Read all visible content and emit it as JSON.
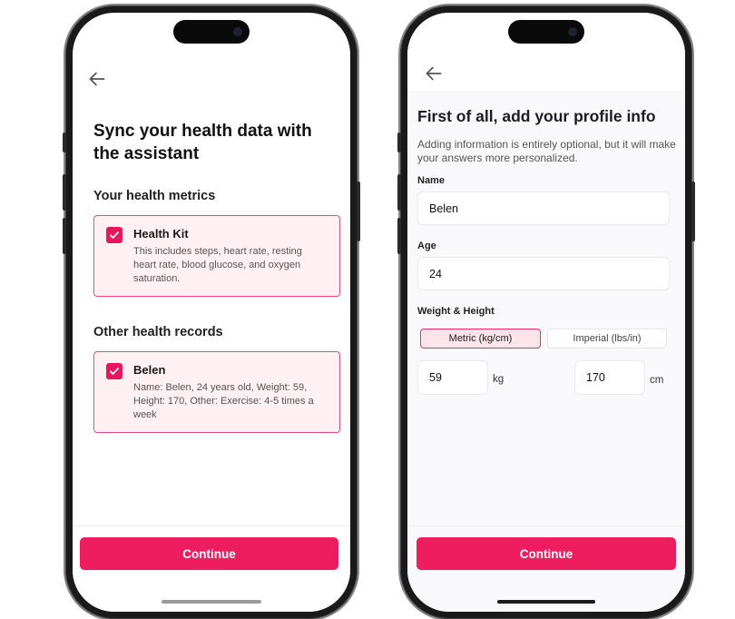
{
  "left_screen": {
    "title": "Sync your health data with the assistant",
    "metrics_section": "Your health metrics",
    "health_kit": {
      "title": "Health Kit",
      "description": "This includes steps, heart rate, resting heart rate, blood glucose, and oxygen saturation.",
      "checked": true
    },
    "records_section": "Other health records",
    "record": {
      "title": "Belen",
      "description": "Name: Belen, 24 years old, Weight: 59, Height: 170, Other: Exercise: 4-5 times a week",
      "checked": true
    },
    "continue_label": "Continue"
  },
  "right_screen": {
    "title": "First of all, add your profile info",
    "subtitle": "Adding information is entirely optional, but it will make your answers more personalized.",
    "name_label": "Name",
    "name_value": "Belen",
    "age_label": "Age",
    "age_value": "24",
    "weight_height_label": "Weight & Height",
    "metric_label": "Metric (kg/cm)",
    "imperial_label": "Imperial (lbs/in)",
    "selected_unit": "metric",
    "weight_value": "59",
    "weight_unit": "kg",
    "height_value": "170",
    "height_unit": "cm",
    "continue_label": "Continue"
  },
  "colors": {
    "accent": "#ee1d5f",
    "card_bg": "#fff0f3",
    "card_border": "#e94b7c",
    "segment_active_bg": "#fde3ea"
  },
  "icons": [
    "back-arrow-icon",
    "checkmark-icon"
  ]
}
